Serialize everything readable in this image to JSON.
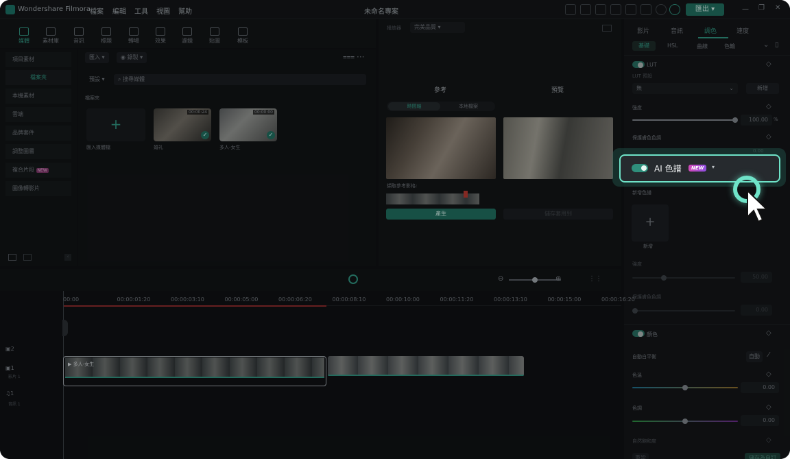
{
  "app": {
    "brand": "Wondershare Filmora",
    "project_title": "未命名專案"
  },
  "menu": [
    "檔案",
    "編輯",
    "工具",
    "視圖",
    "幫助"
  ],
  "export_label": "匯出",
  "toolbar": [
    {
      "label": "媒體",
      "icon": "media-icon",
      "active": true
    },
    {
      "label": "素材庫",
      "icon": "stock-icon"
    },
    {
      "label": "音訊",
      "icon": "music-icon"
    },
    {
      "label": "標題",
      "icon": "title-icon"
    },
    {
      "label": "轉場",
      "icon": "transition-icon"
    },
    {
      "label": "效果",
      "icon": "effects-icon"
    },
    {
      "label": "濾鏡",
      "icon": "filter-icon"
    },
    {
      "label": "貼圖",
      "icon": "sticker-icon"
    },
    {
      "label": "模板",
      "icon": "template-icon"
    }
  ],
  "library": {
    "side_items": [
      "項目素材",
      "檔案夾",
      "本機素材",
      "雲端",
      "品牌套件",
      "調整圖層",
      "複合片段",
      "圖像轉影片"
    ],
    "new_badge": "NEW",
    "import_label": "匯入",
    "record_label": "錄製",
    "preset_label": "預設",
    "search_placeholder": "搜尋媒體",
    "folder_label": "檔案夾",
    "import_media_label": "匯入媒體檔",
    "media": [
      {
        "name": "婚礼",
        "duration": "00:00:24"
      },
      {
        "name": "多人-女生",
        "duration": "00:00:00"
      }
    ]
  },
  "preview": {
    "player_label": "播放器",
    "quality_label": "完美品質",
    "reference_label": "參考",
    "preview_label": "預覽",
    "tab_timeline": "時間軸",
    "tab_local": "本地檔案",
    "pick_frame_label": "擷取參考影格:",
    "generate_label": "產生",
    "save_label": "儲存套用到"
  },
  "right_panel": {
    "tabs": [
      "影片",
      "音訊",
      "調色",
      "速度"
    ],
    "active_tab": "調色",
    "subtabs": [
      "基礎",
      "HSL",
      "曲線",
      "色輪"
    ],
    "lut_label": "LUT",
    "lut_preset_label": "LUT 預設",
    "lut_value": "無",
    "new_label": "新增",
    "strength_label": "強度",
    "strength_value": "100.00",
    "percent": "%",
    "protect_skin_label": "保護膚色色調",
    "protect_skin_value": "0.00",
    "ai_palette_label": "AI 色譜",
    "ai_new_badge": "NEW",
    "add_palette_label": "新增色譜",
    "add_label": "新增",
    "strength2_label": "強度",
    "strength2_value": "50.00",
    "protect_skin2_label": "保護膚色色調",
    "protect_skin2_value": "0.00",
    "color_label": "顏色",
    "auto_wb_label": "自動白平衡",
    "auto_label": "自動",
    "temperature_label": "色溫",
    "temperature_value": "0.00",
    "tint_label": "色調",
    "tint_value": "0.00",
    "vibrance_label": "自然飽和度",
    "reset_label": "重設",
    "save_preset_label": "儲存為自訂"
  },
  "timeline": {
    "ruler": [
      "00:00",
      "00:00:01:20",
      "00:00:03:10",
      "00:00:05:00",
      "00:00:06:20",
      "00:00:08:10",
      "00:00:10:00",
      "00:00:11:20",
      "00:00:13:10",
      "00:00:15:00",
      "00:00:16:20"
    ],
    "tracks": [
      {
        "num": "2",
        "label": ""
      },
      {
        "num": "1",
        "label": "影片 1"
      },
      {
        "num": "1",
        "label": "音訊 1"
      }
    ],
    "clip1_label": "多人-女生"
  }
}
